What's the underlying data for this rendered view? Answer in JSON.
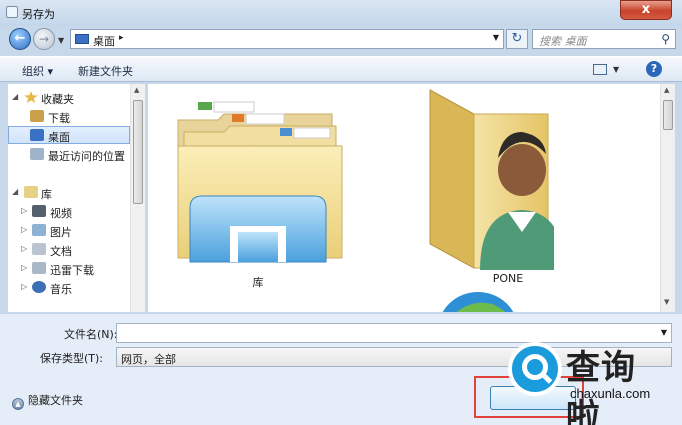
{
  "window": {
    "title": "另存为",
    "close_label": "x"
  },
  "nav": {
    "back_label": "←",
    "forward_label": "→",
    "address_crumb": "桌面",
    "address_sep": "▸",
    "search_placeholder": "搜索 桌面"
  },
  "toolbar": {
    "organize": "组织 ▾",
    "new_folder": "新建文件夹",
    "help": "?"
  },
  "sidebar": {
    "items": [
      {
        "label": "收藏夹",
        "level": 0,
        "arrow": "◢",
        "color": "#e5b84a"
      },
      {
        "label": "下载",
        "level": 1,
        "arrow": "",
        "color": "#caa04a"
      },
      {
        "label": "桌面",
        "level": 1,
        "arrow": "",
        "color": "#3a71c4",
        "selected": true
      },
      {
        "label": "最近访问的位置",
        "level": 1,
        "arrow": "",
        "color": "#9fb3c9"
      },
      {
        "label": "库",
        "level": 0,
        "arrow": "◢",
        "color": "#e8cf86"
      },
      {
        "label": "视频",
        "level": 1,
        "arrow": "▷",
        "color": "#55606e"
      },
      {
        "label": "图片",
        "level": 1,
        "arrow": "▷",
        "color": "#8db0d3"
      },
      {
        "label": "文档",
        "level": 1,
        "arrow": "▷",
        "color": "#b9c4cf"
      },
      {
        "label": "迅雷下载",
        "level": 1,
        "arrow": "▷",
        "color": "#a9b7c6"
      },
      {
        "label": "音乐",
        "level": 1,
        "arrow": "▷",
        "color": "#3d6fb4"
      }
    ]
  },
  "content": {
    "items": [
      {
        "label": "库",
        "icon": "library-folder-icon"
      },
      {
        "label": "PONE",
        "icon": "user-folder-icon"
      },
      {
        "label": "",
        "icon": "network-globe-icon"
      }
    ]
  },
  "form": {
    "filename_label": "文件名(N):",
    "filename_value": "",
    "filetype_label": "保存类型(T):",
    "filetype_value": "网页，全部",
    "hide_folders": "隐藏文件夹"
  },
  "watermark": {
    "cn": "查询啦",
    "en": "chaxunla.com"
  }
}
